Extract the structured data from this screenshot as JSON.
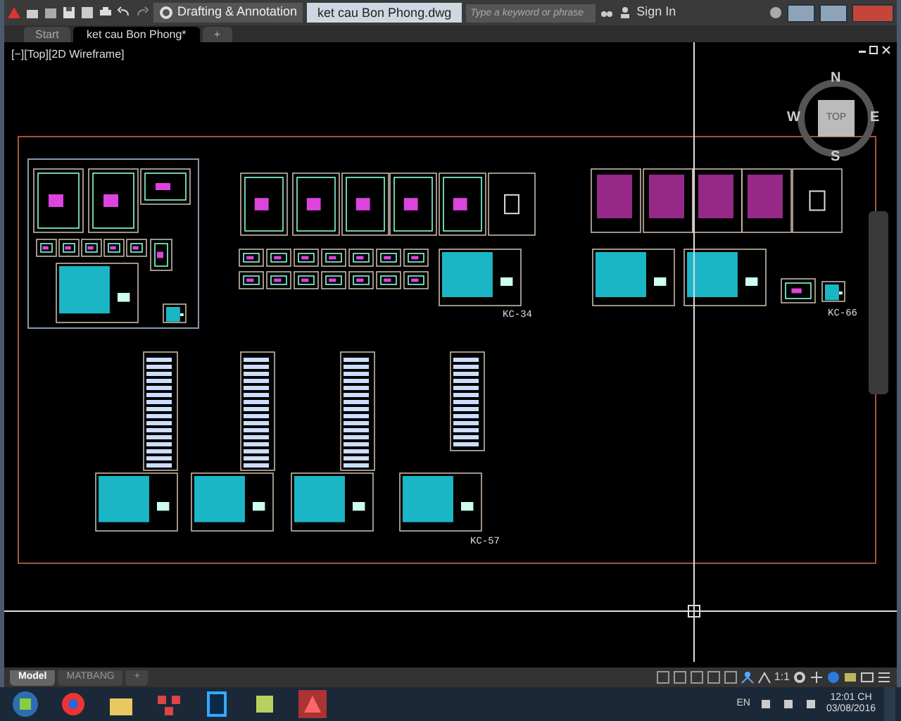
{
  "window": {
    "title": "ket cau Bon Phong.dwg",
    "workspace": "Drafting & Annotation"
  },
  "search": {
    "placeholder": "Type a keyword or phrase"
  },
  "account": {
    "label": "Sign In"
  },
  "doc_tabs": [
    {
      "label": "Start",
      "selected": false
    },
    {
      "label": "ket cau Bon Phong*",
      "selected": true
    },
    {
      "label": "+",
      "selected": false
    }
  ],
  "viewport": {
    "label": "[−][Top][2D Wireframe]",
    "viewcube": {
      "face": "TOP",
      "north": "N",
      "south": "S",
      "east": "E",
      "west": "W"
    },
    "sheet_labels": [
      "KC-34",
      "KC-66",
      "KC-57"
    ]
  },
  "layout_tabs": [
    {
      "label": "Model",
      "selected": true
    },
    {
      "label": "MATBANG",
      "selected": false
    },
    {
      "label": "+",
      "selected": false
    }
  ],
  "status_bar": {
    "scale": "1:1"
  },
  "taskbar": {
    "language": "EN",
    "time": "12:01 CH",
    "date": "03/08/2016"
  }
}
